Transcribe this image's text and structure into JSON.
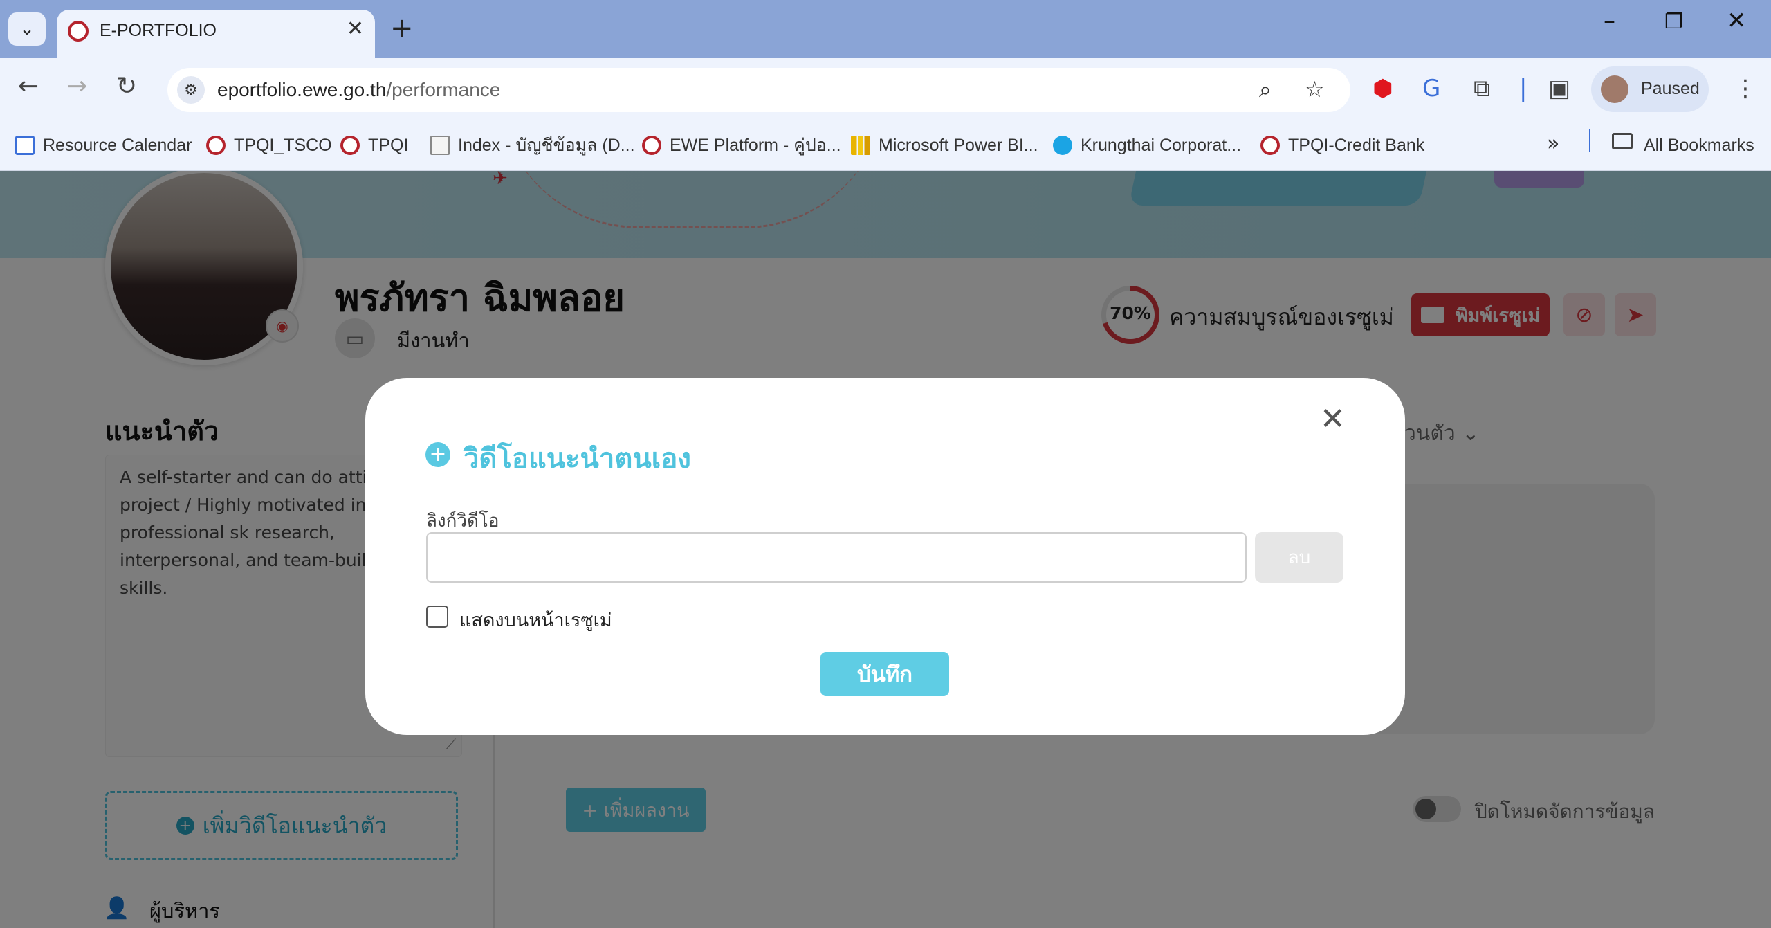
{
  "browser": {
    "tab_title": "E-PORTFOLIO",
    "url_host": "eportfolio.ewe.go.th",
    "url_path": "/performance",
    "profile_label": "Paused",
    "bookmarks": [
      {
        "label": "Resource Calendar",
        "icon": "calendar-icon"
      },
      {
        "label": "TPQI_TSCO",
        "icon": "tpqi-logo-icon"
      },
      {
        "label": "TPQI",
        "icon": "tpqi-logo-icon"
      },
      {
        "label": "Index - บัญชีข้อมูล (D...",
        "icon": "document-icon"
      },
      {
        "label": "EWE Platform - คู่ปอ...",
        "icon": "tpqi-logo-icon"
      },
      {
        "label": "Microsoft Power BI...",
        "icon": "powerbi-icon"
      },
      {
        "label": "Krungthai Corporat...",
        "icon": "krungthai-icon"
      },
      {
        "label": "TPQI-Credit Bank",
        "icon": "tpqi-logo-icon"
      }
    ],
    "all_bookmarks_label": "All Bookmarks"
  },
  "profile": {
    "name": "พรภัทรา ฉิมพลอย",
    "job_status": "มีงานทำ",
    "completeness_percent": "70%",
    "completeness_label": "ความสมบูรณ์ของเรซูเม่",
    "print_resume_label": "พิมพ์เรซูเม่"
  },
  "intro": {
    "title": "แนะนำตัว",
    "text": "A self-starter and can do attitude in project / Highly motivated in professional sk research, interpersonal, and team-building skills.",
    "add_video_label": "เพิ่มวิดีโอแนะนำตัว",
    "executive_label": "ผู้บริหาร"
  },
  "main": {
    "about_label": "วนตัว",
    "add_work_label": "+ เพิ่มผลงาน",
    "toggle_label": "ปิดโหมดจัดการข้อมูล"
  },
  "modal": {
    "title": "วิดีโอแนะนำตนเอง",
    "field_label": "ลิงก์วิดีโอ",
    "input_value": "",
    "delete_label": "ลบ",
    "checkbox_label": "แสดงบนหน้าเรซูเม่",
    "save_label": "บันทึก"
  },
  "colors": {
    "brand_red": "#d9363e",
    "accent_cyan": "#5fcde4",
    "browser_frame": "#8aa4d6"
  }
}
